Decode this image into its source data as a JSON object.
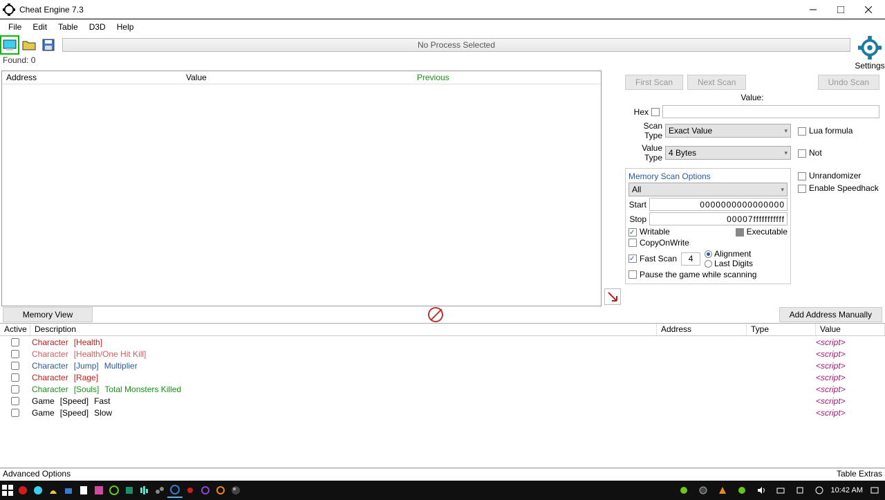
{
  "window": {
    "title": "Cheat Engine 7.3"
  },
  "menu": {
    "file": "File",
    "edit": "Edit",
    "table": "Table",
    "d3d": "D3D",
    "help": "Help"
  },
  "toolbar": {
    "process_label": "No Process Selected",
    "settings_label": "Settings"
  },
  "found": {
    "label": "Found: 0"
  },
  "results_header": {
    "address": "Address",
    "value": "Value",
    "previous": "Previous"
  },
  "scan": {
    "first_scan": "First Scan",
    "next_scan": "Next Scan",
    "undo_scan": "Undo Scan",
    "value_label": "Value:",
    "hex_label": "Hex",
    "scan_type_label": "Scan Type",
    "scan_type_value": "Exact Value",
    "value_type_label": "Value Type",
    "value_type_value": "4 Bytes",
    "lua_formula": "Lua formula",
    "not": "Not",
    "unrandomizer": "Unrandomizer",
    "enable_speedhack": "Enable Speedhack"
  },
  "mso": {
    "title": "Memory Scan Options",
    "region": "All",
    "start_label": "Start",
    "start_value": "0000000000000000",
    "stop_label": "Stop",
    "stop_value": "00007fffffffffff",
    "writable": "Writable",
    "executable": "Executable",
    "copyonwrite": "CopyOnWrite",
    "fast_scan": "Fast Scan",
    "fast_scan_value": "4",
    "alignment": "Alignment",
    "last_digits": "Last Digits",
    "pause": "Pause the game while scanning"
  },
  "midbar": {
    "memory_view": "Memory View",
    "add_address": "Add Address Manually"
  },
  "table": {
    "headers": {
      "active": "Active",
      "description": "Description",
      "address": "Address",
      "type": "Type",
      "value": "Value"
    },
    "rows": [
      {
        "p1": "Character",
        "p1c": "c-red",
        "p2": "[Health]",
        "p2c": "c-red",
        "p3": "",
        "p3c": "",
        "val": "<script>"
      },
      {
        "p1": "Character",
        "p1c": "c-red2",
        "p2": "[Health/One Hit Kill]",
        "p2c": "c-red2",
        "p3": "",
        "p3c": "",
        "val": "<script>"
      },
      {
        "p1": "Character",
        "p1c": "c-blue",
        "p2": "[Jump]",
        "p2c": "c-blue",
        "p3": "Multiplier",
        "p3c": "c-blue",
        "val": "<script>"
      },
      {
        "p1": "Character",
        "p1c": "c-red",
        "p2": "[Rage]",
        "p2c": "c-red",
        "p3": "",
        "p3c": "",
        "val": "<script>"
      },
      {
        "p1": "Character",
        "p1c": "c-green",
        "p2": "[Souls]",
        "p2c": "c-green",
        "p3": "Total Monsters Killed",
        "p3c": "c-green",
        "val": "<script>"
      },
      {
        "p1": "Game",
        "p1c": "",
        "p2": "[Speed]",
        "p2c": "",
        "p3": "Fast",
        "p3c": "",
        "val": "<script>"
      },
      {
        "p1": "Game",
        "p1c": "",
        "p2": "[Speed]",
        "p2c": "",
        "p3": "Slow",
        "p3c": "",
        "val": "<script>"
      }
    ]
  },
  "status": {
    "advanced": "Advanced Options",
    "extras": "Table Extras"
  },
  "taskbar": {
    "time": "10:42 AM"
  }
}
